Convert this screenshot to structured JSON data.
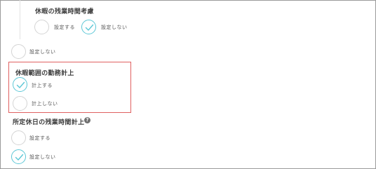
{
  "sections": {
    "overtime_during_leave": {
      "title": "休暇の残業時間考慮",
      "options": [
        {
          "label": "設定する",
          "selected": false
        },
        {
          "label": "設定しない",
          "selected": true
        }
      ]
    },
    "parent_setting": {
      "options": [
        {
          "label": "設定しない",
          "selected": false
        }
      ]
    },
    "leave_range_work_count": {
      "title": "休暇範囲の勤務計上",
      "options": [
        {
          "label": "計上する",
          "selected": true
        },
        {
          "label": "計上しない",
          "selected": false
        }
      ]
    },
    "holiday_overtime_count": {
      "title": "所定休日の残業時間計上",
      "help_icon": "question-circle-icon",
      "options": [
        {
          "label": "設定する",
          "selected": false
        },
        {
          "label": "設定しない",
          "selected": true
        }
      ]
    }
  },
  "colors": {
    "accent_check": "#5cc7d6",
    "highlight_border": "#e06060",
    "radio_border": "#d4d4d4"
  }
}
